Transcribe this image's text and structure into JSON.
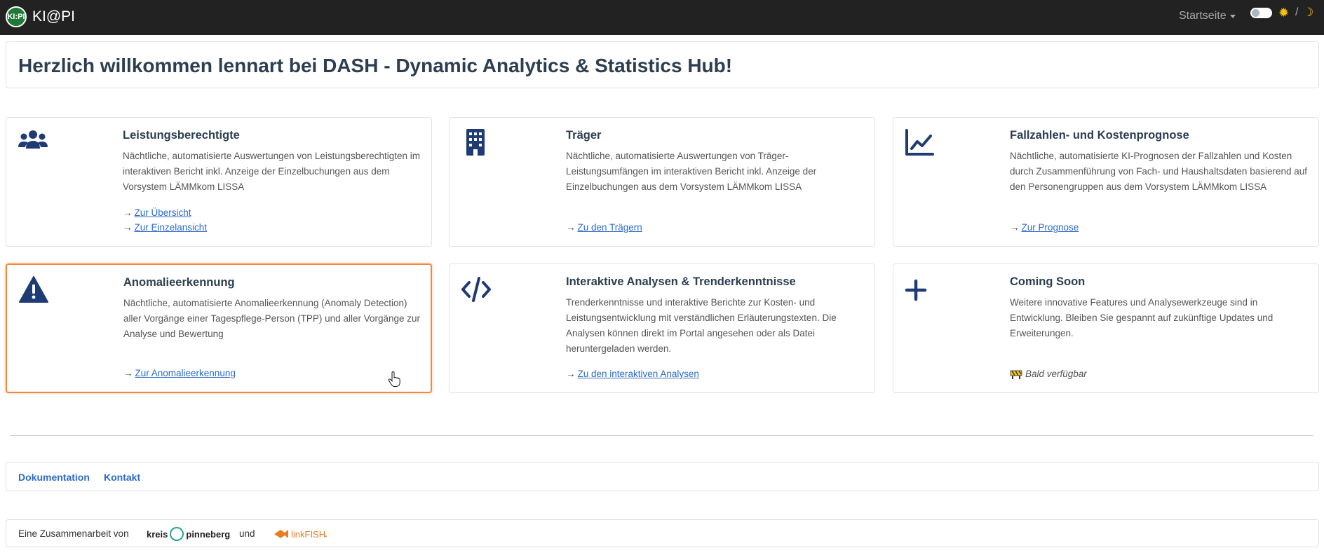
{
  "navbar": {
    "brand_logo_text": "KI:PI",
    "brand_title": "KI@PI",
    "menu_label": "Startseite",
    "sun_icon": "sun-icon",
    "moon_icon": "moon-icon",
    "slash": "/"
  },
  "welcome": {
    "title": "Herzlich willkommen lennart bei DASH - Dynamic Analytics & Statistics Hub!"
  },
  "cards": [
    {
      "icon": "users-icon",
      "title": "Leistungsberechtigte",
      "text": "Nächtliche, automatisierte Auswertungen von Leistungsberechtigten im interaktiven Bericht inkl. Anzeige der Einzelbuchungen aus dem Vorsystem LÄMMkom LISSA",
      "links": [
        "Zur Übersicht",
        "Zur Einzelansicht"
      ]
    },
    {
      "icon": "building-icon",
      "title": "Träger",
      "text": "Nächtliche, automatisierte Auswertungen von Träger-Leistungsumfängen im interaktiven Bericht inkl. Anzeige der Einzelbuchungen aus dem Vorsystem LÄMMkom LISSA",
      "links": [
        "Zu den Trägern"
      ]
    },
    {
      "icon": "chart-line-icon",
      "title": "Fallzahlen- und Kostenprognose",
      "text": "Nächtliche, automatisierte KI-Prognosen der Fallzahlen und Kosten durch Zusammenführung von Fach- und Haushaltsdaten basierend auf den Personengruppen aus dem Vorsystem LÄMMkom LISSA",
      "links": [
        "Zur Prognose"
      ]
    },
    {
      "icon": "warning-icon",
      "title": "Anomalieerkennung",
      "text": "Nächtliche, automatisierte Anomalieerkennung (Anomaly Detection) aller Vorgänge einer Tagespflege-Person (TPP) und aller Vorgänge zur Analyse und Bewertung",
      "links": [
        "Zur Anomalieerkennung"
      ]
    },
    {
      "icon": "code-icon",
      "title": "Interaktive Analysen & Trenderkenntnisse",
      "text": "Trenderkenntnisse und interaktive Berichte zur Kosten- und Leistungsentwicklung mit verständlichen Erläuterungstexten. Die Analysen können direkt im Portal angesehen oder als Datei heruntergeladen werden.",
      "links": [
        "Zu den interaktiven Analysen"
      ]
    },
    {
      "icon": "plus-icon",
      "title": "Coming Soon",
      "text": "Weitere innovative Features und Analysewerkzeuge sind in Entwicklung. Bleiben Sie gespannt auf zukünftige Updates und Erweiterungen.",
      "status_text": "Bald verfügbar",
      "status_icon": "construction-icon"
    }
  ],
  "footer": {
    "links": [
      "Dokumentation",
      "Kontakt"
    ]
  },
  "collab": {
    "prefix": "Eine Zusammenarbeit von",
    "partner1_a": "kreis",
    "partner1_b": "pinneberg",
    "conjunction": "und",
    "partner2": "linkFISH",
    "suffix": "."
  },
  "colors": {
    "navbar_bg": "#222222",
    "icon_blue": "#1f3b73",
    "link_blue": "#2c6ac7",
    "active_border": "#f0883e",
    "title_color": "#2c3e50"
  }
}
